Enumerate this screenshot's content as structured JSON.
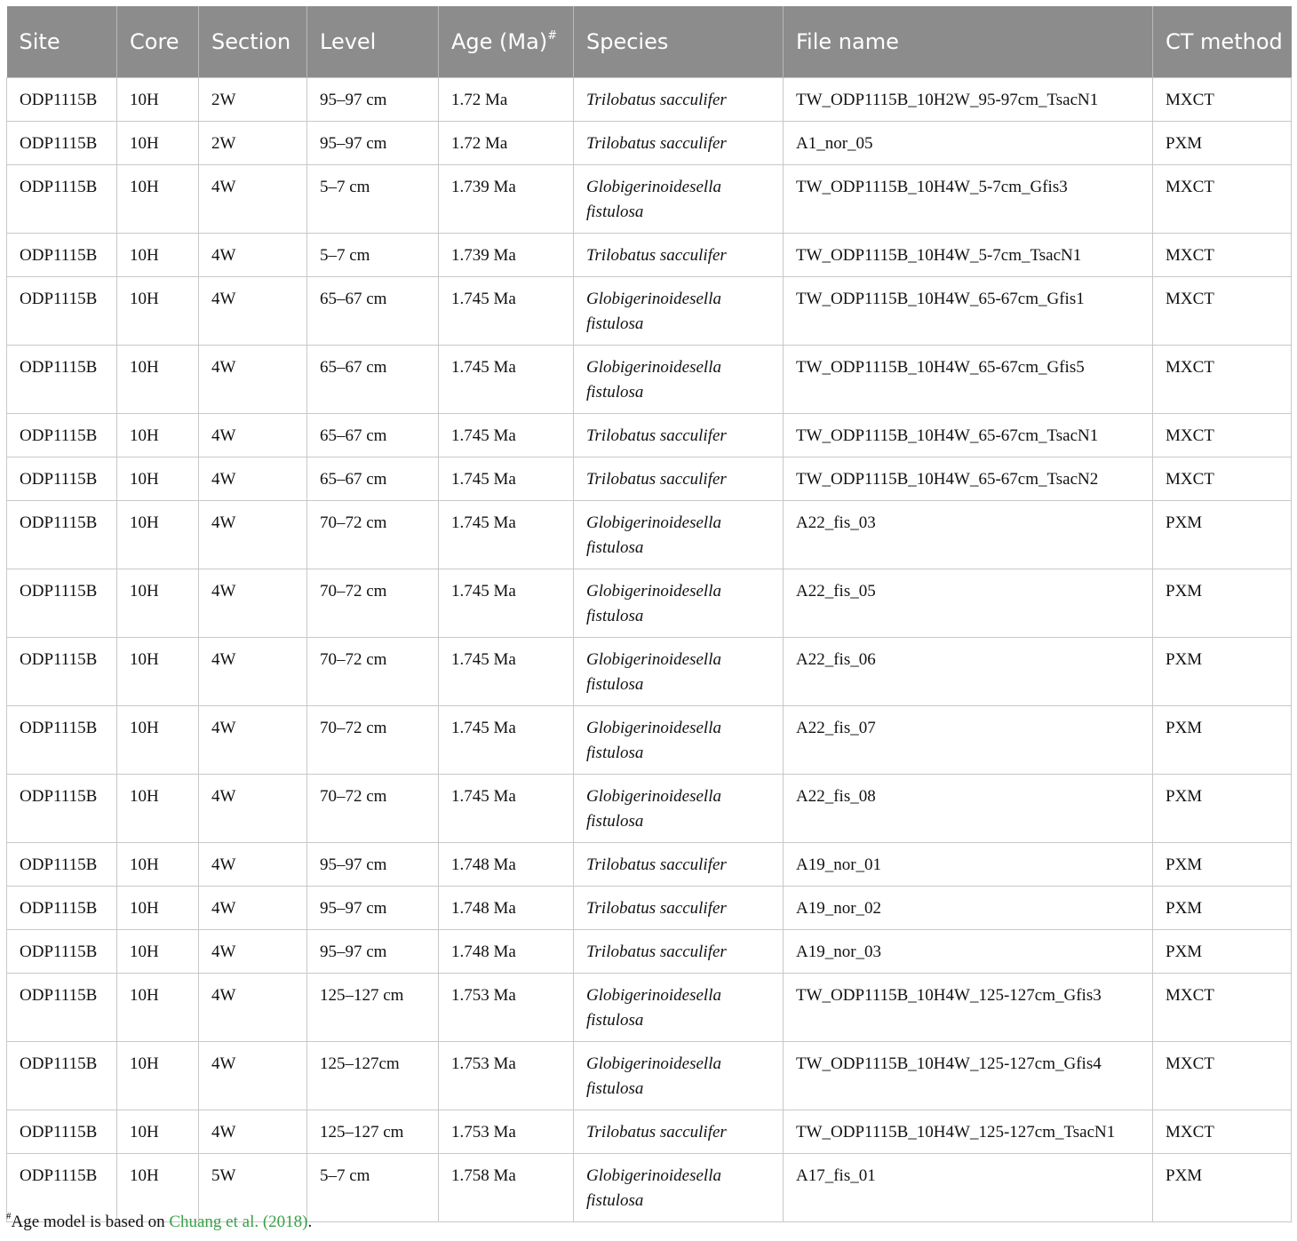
{
  "table": {
    "headers": {
      "site": "Site",
      "core": "Core",
      "section": "Section",
      "level": "Level",
      "age": "Age (Ma)",
      "age_mark": "#",
      "species": "Species",
      "file_name": "File name",
      "ct_method": "CT method"
    },
    "rows": [
      {
        "site": "ODP1115B",
        "core": "10H",
        "section": "2W",
        "level": "95–97 cm",
        "age": "1.72 Ma",
        "species": "Trilobatus sacculifer",
        "file": "TW_ODP1115B_10H2W_95-97cm_TsacN1",
        "method": "MXCT"
      },
      {
        "site": "ODP1115B",
        "core": "10H",
        "section": "2W",
        "level": "95–97 cm",
        "age": "1.72 Ma",
        "species": "Trilobatus sacculifer",
        "file": "A1_nor_05",
        "method": "PXM"
      },
      {
        "site": "ODP1115B",
        "core": "10H",
        "section": "4W",
        "level": "5–7 cm",
        "age": "1.739 Ma",
        "species": "Globigerinoidesella fistulosa",
        "file": "TW_ODP1115B_10H4W_5-7cm_Gfis3",
        "method": "MXCT"
      },
      {
        "site": "ODP1115B",
        "core": "10H",
        "section": "4W",
        "level": "5–7 cm",
        "age": "1.739 Ma",
        "species": "Trilobatus sacculifer",
        "file": "TW_ODP1115B_10H4W_5-7cm_TsacN1",
        "method": "MXCT"
      },
      {
        "site": "ODP1115B",
        "core": "10H",
        "section": "4W",
        "level": "65–67 cm",
        "age": "1.745 Ma",
        "species": "Globigerinoidesella fistulosa",
        "file": "TW_ODP1115B_10H4W_65-67cm_Gfis1",
        "method": "MXCT"
      },
      {
        "site": "ODP1115B",
        "core": "10H",
        "section": "4W",
        "level": "65–67 cm",
        "age": "1.745 Ma",
        "species": "Globigerinoidesella fistulosa",
        "file": "TW_ODP1115B_10H4W_65-67cm_Gfis5",
        "method": "MXCT"
      },
      {
        "site": "ODP1115B",
        "core": "10H",
        "section": "4W",
        "level": "65–67 cm",
        "age": "1.745 Ma",
        "species": "Trilobatus sacculifer",
        "file": "TW_ODP1115B_10H4W_65-67cm_TsacN1",
        "method": "MXCT"
      },
      {
        "site": "ODP1115B",
        "core": "10H",
        "section": "4W",
        "level": "65–67 cm",
        "age": "1.745 Ma",
        "species": "Trilobatus sacculifer",
        "file": "TW_ODP1115B_10H4W_65-67cm_TsacN2",
        "method": "MXCT"
      },
      {
        "site": "ODP1115B",
        "core": "10H",
        "section": "4W",
        "level": "70–72 cm",
        "age": "1.745 Ma",
        "species": "Globigerinoidesella fistulosa",
        "file": "A22_fis_03",
        "method": "PXM"
      },
      {
        "site": "ODP1115B",
        "core": "10H",
        "section": "4W",
        "level": "70–72 cm",
        "age": "1.745 Ma",
        "species": "Globigerinoidesella fistulosa",
        "file": "A22_fis_05",
        "method": "PXM"
      },
      {
        "site": "ODP1115B",
        "core": "10H",
        "section": "4W",
        "level": "70–72 cm",
        "age": "1.745 Ma",
        "species": "Globigerinoidesella fistulosa",
        "file": "A22_fis_06",
        "method": "PXM"
      },
      {
        "site": "ODP1115B",
        "core": "10H",
        "section": "4W",
        "level": "70–72 cm",
        "age": "1.745 Ma",
        "species": "Globigerinoidesella fistulosa",
        "file": "A22_fis_07",
        "method": "PXM"
      },
      {
        "site": "ODP1115B",
        "core": "10H",
        "section": "4W",
        "level": "70–72 cm",
        "age": "1.745 Ma",
        "species": "Globigerinoidesella fistulosa",
        "file": "A22_fis_08",
        "method": "PXM"
      },
      {
        "site": "ODP1115B",
        "core": "10H",
        "section": "4W",
        "level": "95–97 cm",
        "age": "1.748 Ma",
        "species": "Trilobatus sacculifer",
        "file": "A19_nor_01",
        "method": "PXM"
      },
      {
        "site": "ODP1115B",
        "core": "10H",
        "section": "4W",
        "level": "95–97 cm",
        "age": "1.748 Ma",
        "species": "Trilobatus sacculifer",
        "file": "A19_nor_02",
        "method": "PXM"
      },
      {
        "site": "ODP1115B",
        "core": "10H",
        "section": "4W",
        "level": "95–97 cm",
        "age": "1.748 Ma",
        "species": "Trilobatus sacculifer",
        "file": "A19_nor_03",
        "method": "PXM"
      },
      {
        "site": "ODP1115B",
        "core": "10H",
        "section": "4W",
        "level": "125–127 cm",
        "age": "1.753 Ma",
        "species": "Globigerinoidesella fistulosa",
        "file": "TW_ODP1115B_10H4W_125-127cm_Gfis3",
        "method": "MXCT"
      },
      {
        "site": "ODP1115B",
        "core": "10H",
        "section": "4W",
        "level": "125–127cm",
        "age": "1.753 Ma",
        "species": "Globigerinoidesella fistulosa",
        "file": "TW_ODP1115B_10H4W_125-127cm_Gfis4",
        "method": "MXCT"
      },
      {
        "site": "ODP1115B",
        "core": "10H",
        "section": "4W",
        "level": "125–127 cm",
        "age": "1.753 Ma",
        "species": "Trilobatus sacculifer",
        "file": "TW_ODP1115B_10H4W_125-127cm_TsacN1",
        "method": "MXCT"
      },
      {
        "site": "ODP1115B",
        "core": "10H",
        "section": "5W",
        "level": "5–7 cm",
        "age": "1.758 Ma",
        "species": "Globigerinoidesella fistulosa",
        "file": "A17_fis_01",
        "method": "PXM"
      }
    ]
  },
  "footnote": {
    "mark": "#",
    "text_before": "Age model is based on ",
    "link_text": "Chuang et al. (2018)",
    "text_after": ".",
    "link_color": "#3aa04a"
  },
  "colors": {
    "header_bg": "#8c8c8c",
    "header_text": "#ffffff",
    "grid": "#c8c8c8"
  }
}
